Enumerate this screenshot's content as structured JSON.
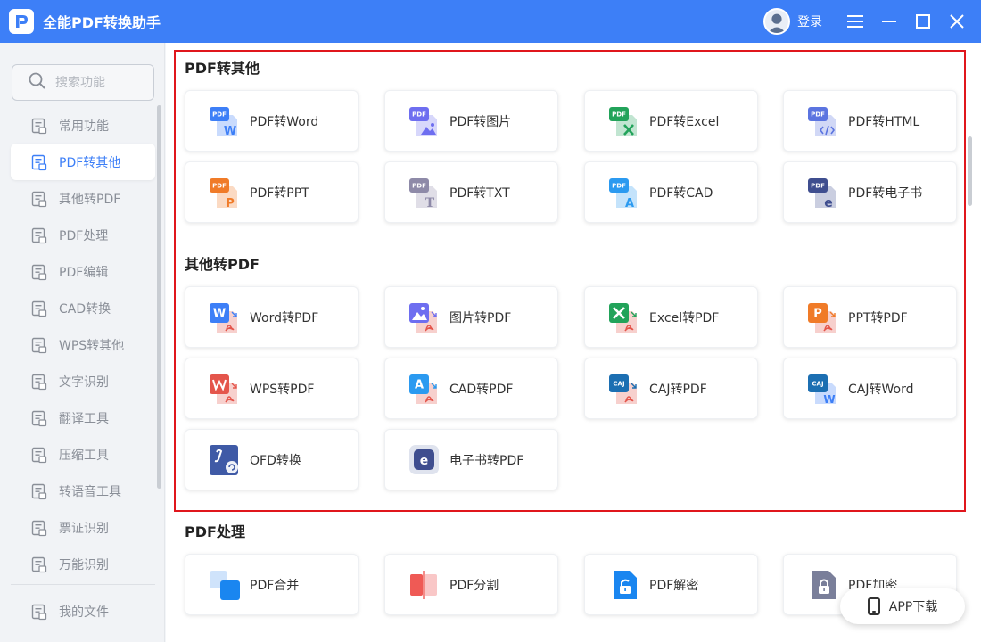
{
  "app": {
    "title": "全能PDF转换助手",
    "login_label": "登录"
  },
  "search": {
    "placeholder": "搜索功能"
  },
  "sidebar": {
    "items": [
      {
        "label": "常用功能",
        "icon": "common-functions-icon"
      },
      {
        "label": "PDF转其他",
        "icon": "pdf-to-other-icon",
        "active": true
      },
      {
        "label": "其他转PDF",
        "icon": "other-to-pdf-icon"
      },
      {
        "label": "PDF处理",
        "icon": "pdf-process-icon"
      },
      {
        "label": "PDF编辑",
        "icon": "pdf-edit-icon"
      },
      {
        "label": "CAD转换",
        "icon": "cad-convert-icon"
      },
      {
        "label": "WPS转其他",
        "icon": "wps-convert-icon"
      },
      {
        "label": "文字识别",
        "icon": "ocr-icon"
      },
      {
        "label": "翻译工具",
        "icon": "translate-icon"
      },
      {
        "label": "压缩工具",
        "icon": "compress-icon"
      },
      {
        "label": "转语音工具",
        "icon": "text-to-speech-icon"
      },
      {
        "label": "票证识别",
        "icon": "ticket-recognition-icon"
      },
      {
        "label": "万能识别",
        "icon": "universal-recognition-icon"
      }
    ],
    "bottom": {
      "label": "我的文件",
      "icon": "my-files-icon"
    }
  },
  "sections": {
    "pdf_to_other": {
      "title": "PDF转其他",
      "cards": [
        {
          "label": "PDF转Word",
          "icon": "pdf-to-word-icon"
        },
        {
          "label": "PDF转图片",
          "icon": "pdf-to-image-icon"
        },
        {
          "label": "PDF转Excel",
          "icon": "pdf-to-excel-icon"
        },
        {
          "label": "PDF转HTML",
          "icon": "pdf-to-html-icon"
        },
        {
          "label": "PDF转PPT",
          "icon": "pdf-to-ppt-icon"
        },
        {
          "label": "PDF转TXT",
          "icon": "pdf-to-txt-icon"
        },
        {
          "label": "PDF转CAD",
          "icon": "pdf-to-cad-icon"
        },
        {
          "label": "PDF转电子书",
          "icon": "pdf-to-ebook-icon"
        }
      ]
    },
    "other_to_pdf": {
      "title": "其他转PDF",
      "cards": [
        {
          "label": "Word转PDF",
          "icon": "word-to-pdf-icon"
        },
        {
          "label": "图片转PDF",
          "icon": "image-to-pdf-icon"
        },
        {
          "label": "Excel转PDF",
          "icon": "excel-to-pdf-icon"
        },
        {
          "label": "PPT转PDF",
          "icon": "ppt-to-pdf-icon"
        },
        {
          "label": "WPS转PDF",
          "icon": "wps-to-pdf-icon"
        },
        {
          "label": "CAD转PDF",
          "icon": "cad-to-pdf-icon"
        },
        {
          "label": "CAJ转PDF",
          "icon": "caj-to-pdf-icon"
        },
        {
          "label": "CAJ转Word",
          "icon": "caj-to-word-icon"
        },
        {
          "label": "OFD转换",
          "icon": "ofd-convert-icon"
        },
        {
          "label": "电子书转PDF",
          "icon": "ebook-to-pdf-icon"
        }
      ]
    },
    "pdf_process": {
      "title": "PDF处理",
      "cards": [
        {
          "label": "PDF合并",
          "icon": "pdf-merge-icon"
        },
        {
          "label": "PDF分割",
          "icon": "pdf-split-icon"
        },
        {
          "label": "PDF解密",
          "icon": "pdf-decrypt-icon"
        },
        {
          "label": "PDF加密",
          "icon": "pdf-encrypt-icon"
        }
      ]
    }
  },
  "icon_text": {
    "pdf": "PDF",
    "w": "W",
    "p": "P",
    "t": "T",
    "a": "A",
    "e": "e",
    "caj": "CAJ"
  },
  "app_download": {
    "label": "APP下载"
  },
  "colors": {
    "titlebar": "#3d7ff7",
    "accent": "#3d7ff7",
    "highlight_border": "#e0161c"
  }
}
